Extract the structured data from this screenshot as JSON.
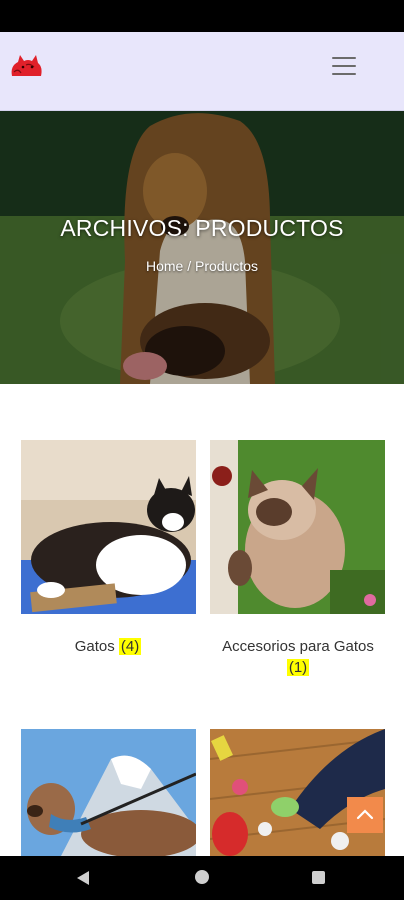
{
  "hero": {
    "title": "ARCHIVOS: PRODUCTOS",
    "breadcrumb_home": "Home",
    "breadcrumb_separator": " / ",
    "breadcrumb_current": "Productos"
  },
  "categories": [
    {
      "name": "Gatos",
      "count": "(4)"
    },
    {
      "name": "Accesorios para Gatos",
      "count": "(1)"
    },
    {
      "name": "",
      "count": ""
    },
    {
      "name": "",
      "count": ""
    }
  ],
  "colors": {
    "header_bg": "#e8e6fb",
    "accent": "#f28a4b",
    "count_highlight": "#ffff00"
  },
  "icons": {
    "logo": "red-cat-logo-icon",
    "menu": "hamburger-menu-icon",
    "scroll_top": "chevron-up-icon",
    "nav": [
      "back-triangle-icon",
      "home-circle-icon",
      "recent-square-icon"
    ]
  }
}
